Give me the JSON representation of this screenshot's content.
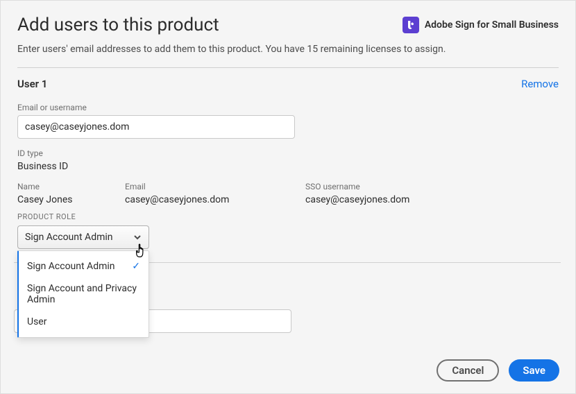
{
  "header": {
    "title": "Add users to this product",
    "product_name": "Adobe Sign for Small Business",
    "subtitle": "Enter users' email addresses to add them to this product. You have 15 remaining licenses to assign."
  },
  "user": {
    "heading": "User 1",
    "remove_label": "Remove",
    "email_label": "Email or username",
    "email_value": "casey@caseyjones.dom",
    "idtype_label": "ID type",
    "idtype_value": "Business ID",
    "name_label": "Name",
    "name_value": "Casey Jones",
    "email_col_label": "Email",
    "email_col_value": "casey@caseyjones.dom",
    "sso_label": "SSO username",
    "sso_value": "casey@caseyjones.dom",
    "role_label": "PRODUCT ROLE",
    "role_selected": "Sign Account Admin",
    "role_options": {
      "opt1": "Sign Account Admin",
      "opt2": "Sign Account and Privacy Admin",
      "opt3": "User"
    }
  },
  "footer": {
    "cancel": "Cancel",
    "save": "Save"
  }
}
